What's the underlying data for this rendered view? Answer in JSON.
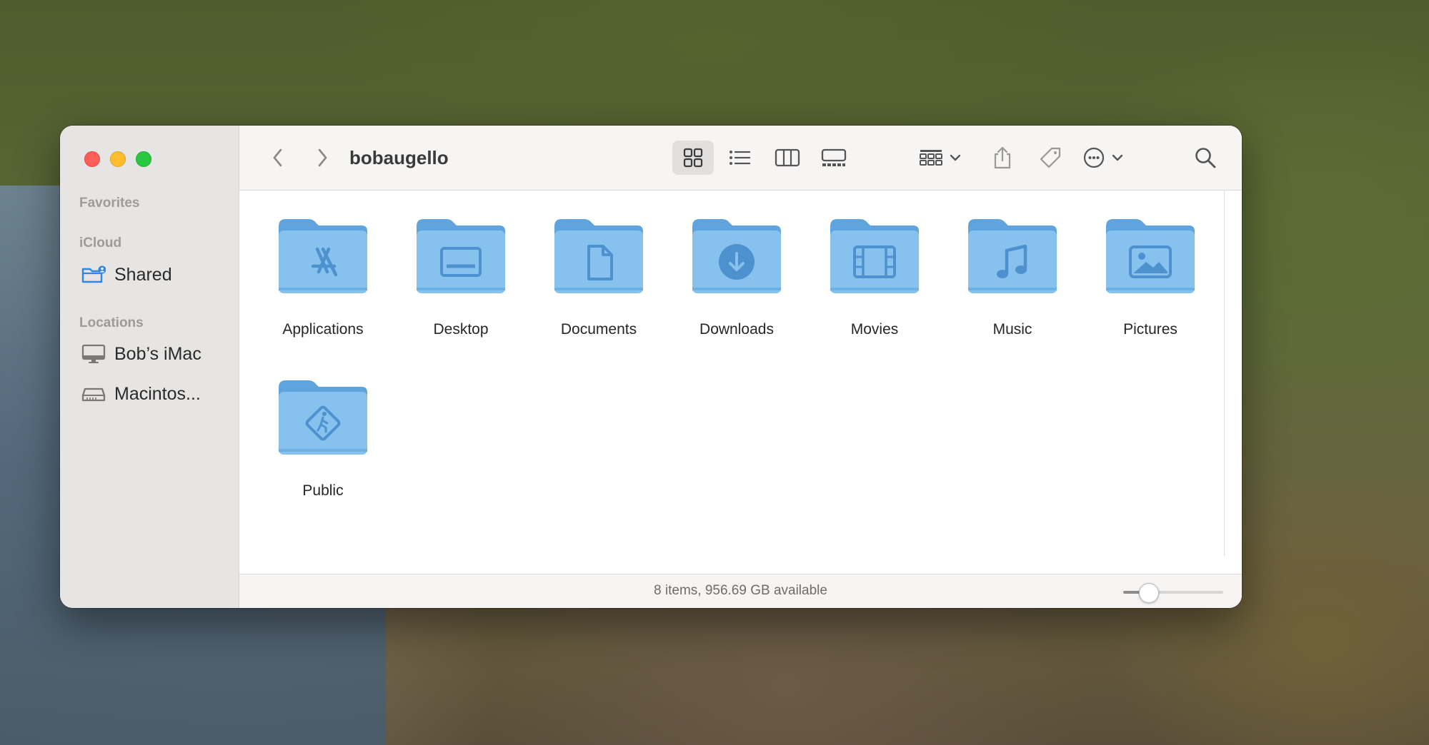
{
  "window": {
    "title": "bobaugello",
    "colors": {
      "folder_blue": "#87c2ee",
      "folder_dark": "#5fa4dc",
      "glyph": "#4d91cf"
    }
  },
  "sidebar": {
    "sections": [
      {
        "label": "Favorites",
        "items": []
      },
      {
        "label": "iCloud",
        "items": [
          {
            "label": "Shared",
            "icon": "shared-folder-icon"
          }
        ]
      },
      {
        "label": "Locations",
        "items": [
          {
            "label": "Bob’s iMac",
            "icon": "imac-icon"
          },
          {
            "label": "Macintos...",
            "icon": "hard-drive-icon"
          }
        ]
      }
    ]
  },
  "toolbar": {
    "back_icon": "chevron-left-icon",
    "forward_icon": "chevron-right-icon",
    "views": [
      "icon-view",
      "list-view",
      "column-view",
      "gallery-view"
    ],
    "active_view": "icon-view",
    "actions": [
      "group-icon",
      "share-icon",
      "tag-icon",
      "more-icon",
      "search-icon"
    ]
  },
  "folders": [
    {
      "label": "Applications",
      "glyph": "applications"
    },
    {
      "label": "Desktop",
      "glyph": "desktop"
    },
    {
      "label": "Documents",
      "glyph": "documents"
    },
    {
      "label": "Downloads",
      "glyph": "downloads"
    },
    {
      "label": "Movies",
      "glyph": "movies"
    },
    {
      "label": "Music",
      "glyph": "music"
    },
    {
      "label": "Pictures",
      "glyph": "pictures"
    },
    {
      "label": "Public",
      "glyph": "public"
    }
  ],
  "status": {
    "text": "8 items, 956.69 GB available",
    "zoom_fraction": 0.25
  }
}
